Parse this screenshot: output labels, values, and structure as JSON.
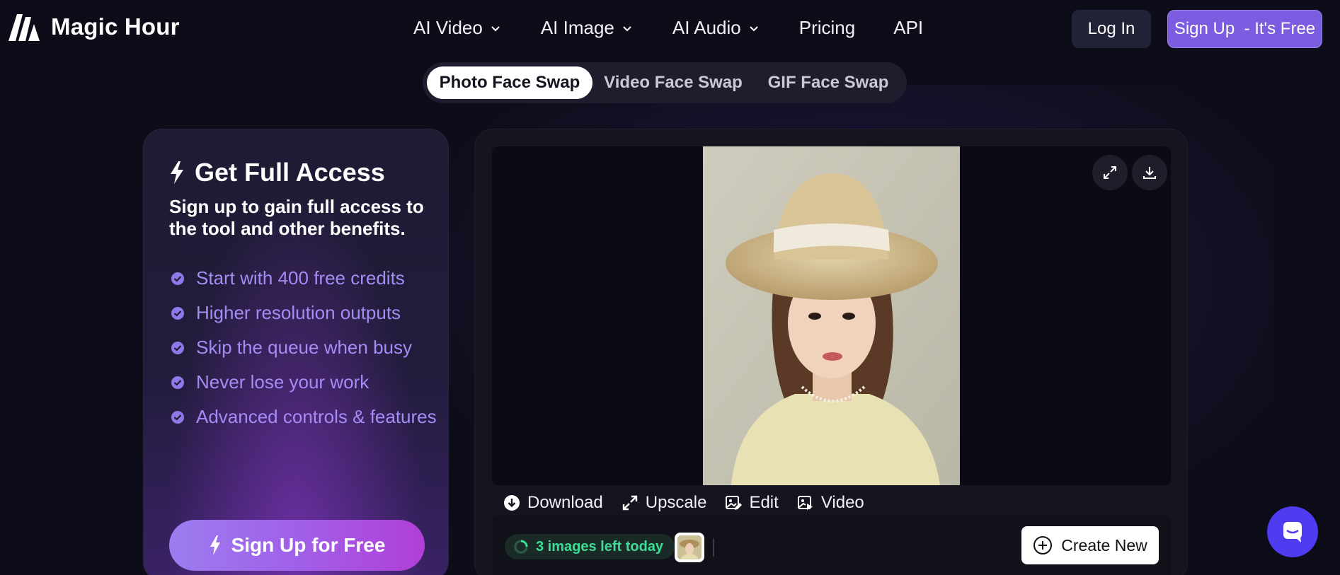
{
  "brand": {
    "name": "Magic Hour",
    "logo_icon": "magic-hour-logo"
  },
  "nav": {
    "items": [
      {
        "label": "AI Video",
        "has_dropdown": true
      },
      {
        "label": "AI Image",
        "has_dropdown": true
      },
      {
        "label": "AI Audio",
        "has_dropdown": true
      },
      {
        "label": "Pricing",
        "has_dropdown": false
      },
      {
        "label": "API",
        "has_dropdown": false
      }
    ],
    "login_label": "Log In",
    "signup_label": "Sign Up  - It's Free"
  },
  "tabs": [
    {
      "label": "Photo Face Swap",
      "active": true
    },
    {
      "label": "Video Face Swap",
      "active": false
    },
    {
      "label": "GIF Face Swap",
      "active": false
    }
  ],
  "access": {
    "title": "Get Full Access",
    "subtitle": "Sign up to gain full access to the tool and other benefits.",
    "benefits": [
      "Start with 400 free credits",
      "Higher resolution outputs",
      "Skip the queue when busy",
      "Never lose your work",
      "Advanced controls & features"
    ],
    "cta_label": "Sign Up for Free"
  },
  "result": {
    "actions": {
      "download": "Download",
      "upscale": "Upscale",
      "edit": "Edit",
      "video": "Video"
    },
    "quota_text": "3 images left today",
    "create_new_label": "Create New"
  },
  "colors": {
    "accent": "#7c5ce0",
    "benefit_text": "#a58cf5",
    "quota_green": "#3ddc97",
    "chat_button": "#4f3cf0"
  }
}
